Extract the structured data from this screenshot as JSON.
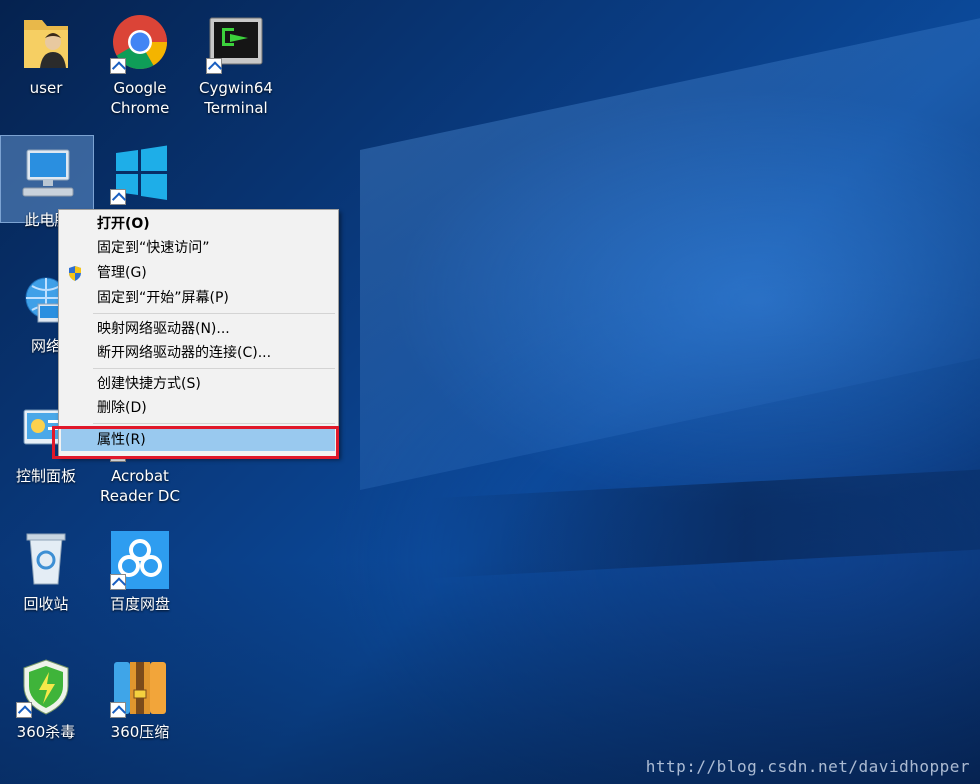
{
  "desktop": {
    "icons": [
      {
        "label": "user"
      },
      {
        "label": "Google\nChrome"
      },
      {
        "label": "Cygwin64\nTerminal"
      },
      {
        "label": "此电脑"
      },
      {
        "label": "微软"
      },
      {
        "label": "网络"
      },
      {
        "label": "控制面板"
      },
      {
        "label": "Acrobat\nReader DC"
      },
      {
        "label": "回收站"
      },
      {
        "label": "百度网盘"
      },
      {
        "label": "360杀毒"
      },
      {
        "label": "360压缩"
      }
    ]
  },
  "context_menu": {
    "items": [
      {
        "label": "打开(O)"
      },
      {
        "label": "固定到“快速访问”"
      },
      {
        "label": "管理(G)"
      },
      {
        "label": "固定到“开始”屏幕(P)"
      },
      {
        "label": "映射网络驱动器(N)..."
      },
      {
        "label": "断开网络驱动器的连接(C)..."
      },
      {
        "label": "创建快捷方式(S)"
      },
      {
        "label": "删除(D)"
      },
      {
        "label": "属性(R)"
      }
    ],
    "highlighted_item": "属性(R)",
    "highlight_color": "#99c9ef",
    "annotation_color": "#e0182a"
  },
  "watermark": "http://blog.csdn.net/davidhopper"
}
